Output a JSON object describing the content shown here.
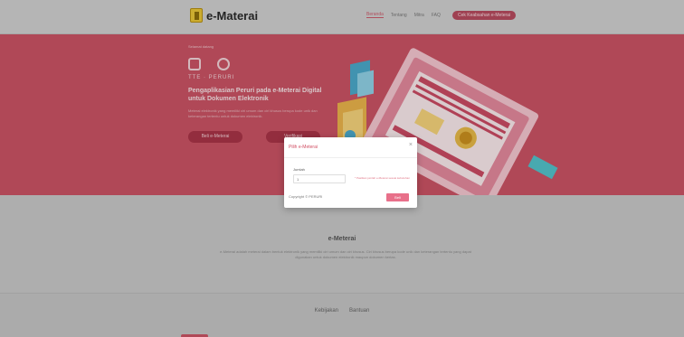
{
  "nav": {
    "logo_text": "e-Materai",
    "links": [
      "Beranda",
      "Tentang",
      "Mitra",
      "FAQ"
    ],
    "cta_label": "Cek Keabsahan e-Meterai"
  },
  "hero": {
    "small_text": "Selamat datang",
    "tagline": "TTE · PERURI",
    "title": "Pengaplikasian Peruri pada e-Meterai Digital untuk Dokumen Elektronik",
    "description": "Meterai elektronik yang memiliki ciri umum dan ciri khusus berupa kode unik dan keterangan tertentu untuk dokumen elektronik.",
    "button1": "Beli e-Meterai",
    "button2": "Verifikasi"
  },
  "modal": {
    "title": "Pilih e-Meterai",
    "field_label": "Jumlah",
    "field_value": "1",
    "help_text": "* Pastikan jumlah e-Meterai sesuai kebutuhan",
    "copyright": "Copyright © PERURI",
    "submit_label": "Beli"
  },
  "about": {
    "title": "e-Meterai",
    "text": "e-Meterai adalah meterai dalam bentuk elektronik yang memiliki ciri umum dan ciri khusus. Ciri khusus berupa kode unik dan keterangan tertentu yang dapat digunakan untuk dokumen elektronik maupun dokumen kertas."
  },
  "footer": {
    "links": [
      "Kebijakan",
      "Bantuan"
    ]
  },
  "colors": {
    "brand": "#c95363",
    "accent": "#e8708a",
    "logo": "#e8c437"
  },
  "icons": [
    "logo-mark-icon",
    "document-icon",
    "stamp-icon",
    "close-icon"
  ]
}
